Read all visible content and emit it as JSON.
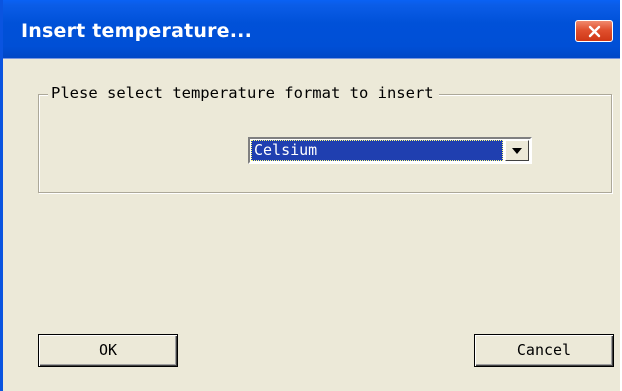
{
  "window": {
    "title": "Insert temperature..."
  },
  "group": {
    "legend": "Plese select temperature format to insert"
  },
  "format_select": {
    "selected": "Celsium"
  },
  "buttons": {
    "ok": "OK",
    "cancel": "Cancel"
  },
  "colors": {
    "titlebar": "#0051d8",
    "dialog_background": "#ece9d8",
    "selection_highlight": "#1f3fb0",
    "close_button": "#e0502e"
  },
  "icons": {
    "close": "close-icon",
    "dropdown": "chevron-down-icon"
  }
}
